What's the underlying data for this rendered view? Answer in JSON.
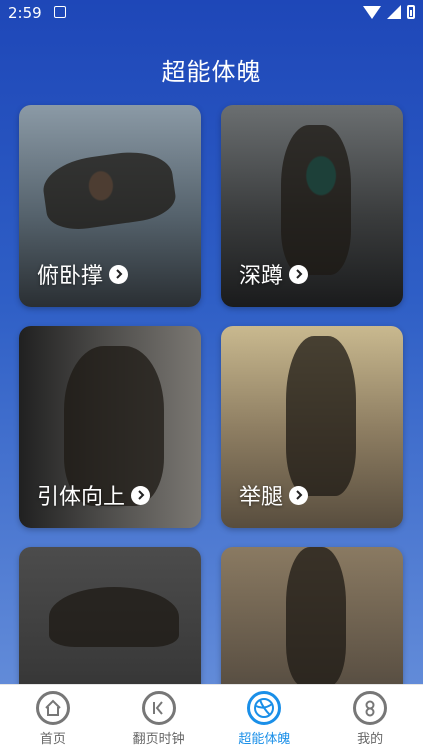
{
  "status": {
    "time": "2:59"
  },
  "page": {
    "title": "超能体魄"
  },
  "cards": [
    {
      "label": "俯卧撑"
    },
    {
      "label": "深蹲"
    },
    {
      "label": "引体向上"
    },
    {
      "label": "举腿"
    },
    {
      "label": ""
    },
    {
      "label": ""
    }
  ],
  "tabs": [
    {
      "label": "首页",
      "icon": "home-icon",
      "active": false
    },
    {
      "label": "翻页时钟",
      "icon": "back-arrow-icon",
      "active": false
    },
    {
      "label": "超能体魄",
      "icon": "basketball-icon",
      "active": true
    },
    {
      "label": "我的",
      "icon": "profile-icon",
      "active": false
    }
  ],
  "colors": {
    "accent": "#1a8fe8",
    "header": "#1e47b8"
  }
}
